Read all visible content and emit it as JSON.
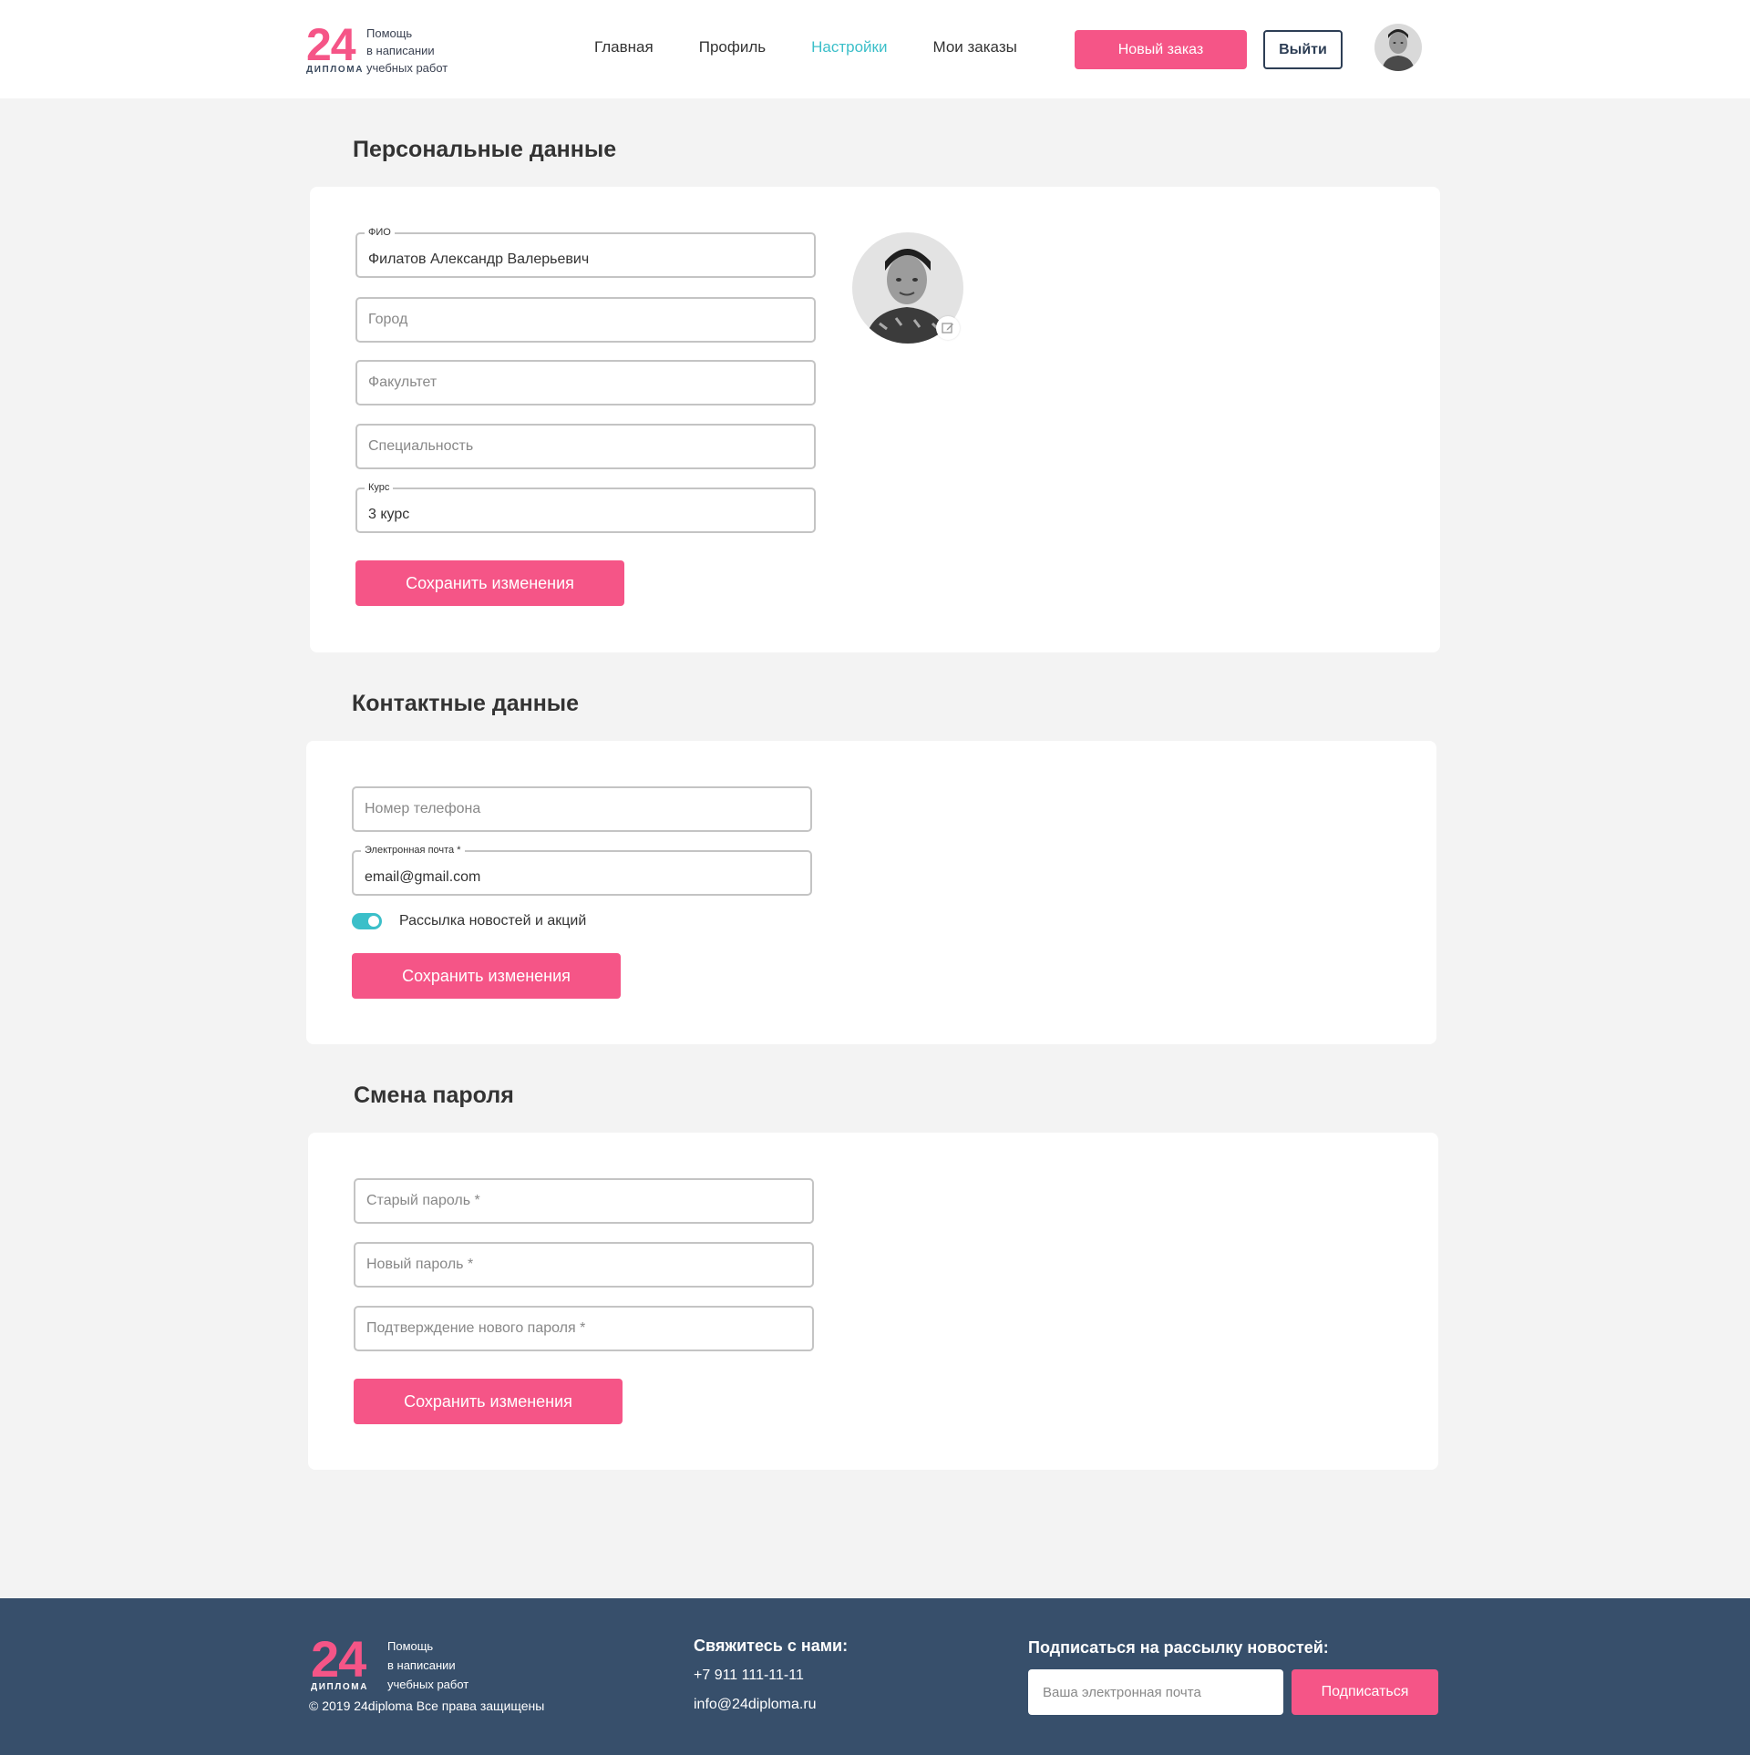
{
  "logo": {
    "number": "24",
    "word": "ДИПЛОМА",
    "tagline": [
      "Помощь",
      "в написании",
      "учебных работ"
    ]
  },
  "nav": {
    "items": [
      {
        "label": "Главная"
      },
      {
        "label": "Профиль"
      },
      {
        "label": "Настройки",
        "active": true
      },
      {
        "label": "Мои заказы"
      }
    ],
    "new_order_label": "Новый заказ",
    "logout_label": "Выйти"
  },
  "personal": {
    "title": "Персональные данные",
    "fio_label": "ФИО",
    "fio_value": "Филатов Александр Валерьевич",
    "city_placeholder": "Город",
    "faculty_placeholder": "Факультет",
    "specialty_placeholder": "Специальность",
    "course_label": "Курс",
    "course_value": "3 курс",
    "save_label": "Сохранить изменения"
  },
  "contacts": {
    "title": "Контактные данные",
    "phone_placeholder": "Номер телефона",
    "email_label": "Электронная почта *",
    "email_value": "email@gmail.com",
    "newsletter_label": "Рассылка новостей и акций",
    "newsletter_on": true,
    "save_label": "Сохранить изменения"
  },
  "password": {
    "title": "Смена пароля",
    "old_placeholder": "Старый пароль *",
    "new_placeholder": "Новый пароль *",
    "confirm_placeholder": "Подтверждение нового пароля *",
    "save_label": "Сохранить изменения"
  },
  "footer": {
    "copyright": "© 2019 24diploma Все права защищены",
    "contact_heading": "Свяжитесь с нами:",
    "phone": "+7 911 111-11-11",
    "email": "info@24diploma.ru",
    "subscribe_heading": "Подписаться на рассылку новостей:",
    "subscribe_placeholder": "Ваша электронная почта",
    "subscribe_button": "Подписаться"
  },
  "colors": {
    "accent": "#f55587",
    "active_nav": "#3bbfc9",
    "footer_bg": "#374f6b",
    "page_bg": "#f3f3f3"
  }
}
